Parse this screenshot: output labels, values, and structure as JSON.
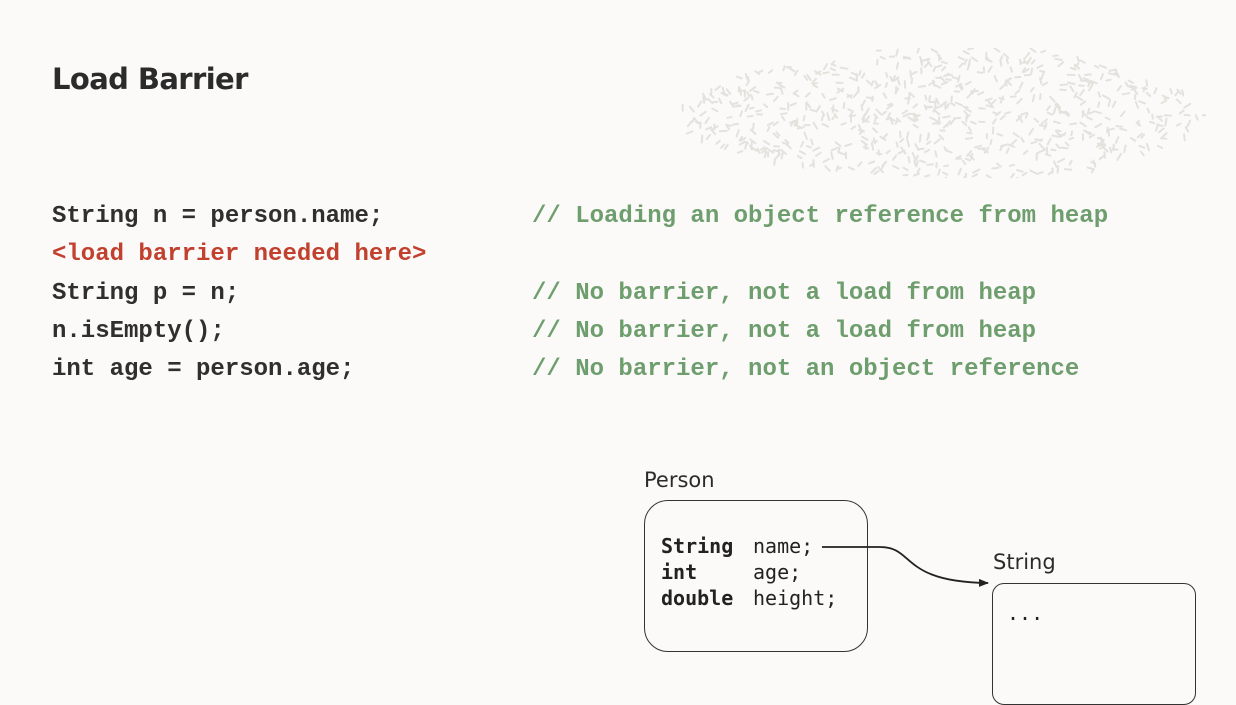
{
  "slide": {
    "title": "Load Barrier"
  },
  "code_lines": [
    {
      "code": "String n = person.name;",
      "comment": "// Loading an object reference from heap"
    },
    {
      "code": "<load barrier needed here>",
      "comment": ""
    },
    {
      "code": "String p = n;",
      "comment": "// No barrier, not a load from heap"
    },
    {
      "code": "n.isEmpty();",
      "comment": "// No barrier, not a load from heap"
    },
    {
      "code": "int age = person.age;",
      "comment": "// No barrier, not an object reference"
    }
  ],
  "diagram": {
    "person": {
      "label": "Person",
      "fields": [
        {
          "type": "String",
          "name": "name;"
        },
        {
          "type": "int",
          "name": "age;"
        },
        {
          "type": "double",
          "name": "height;"
        }
      ]
    },
    "string": {
      "label": "String",
      "content": "..."
    }
  },
  "colors": {
    "highlight": "#c1402e",
    "comment": "#6e9e6e",
    "text": "#2f2f2f",
    "background": "#fbfaf8"
  }
}
